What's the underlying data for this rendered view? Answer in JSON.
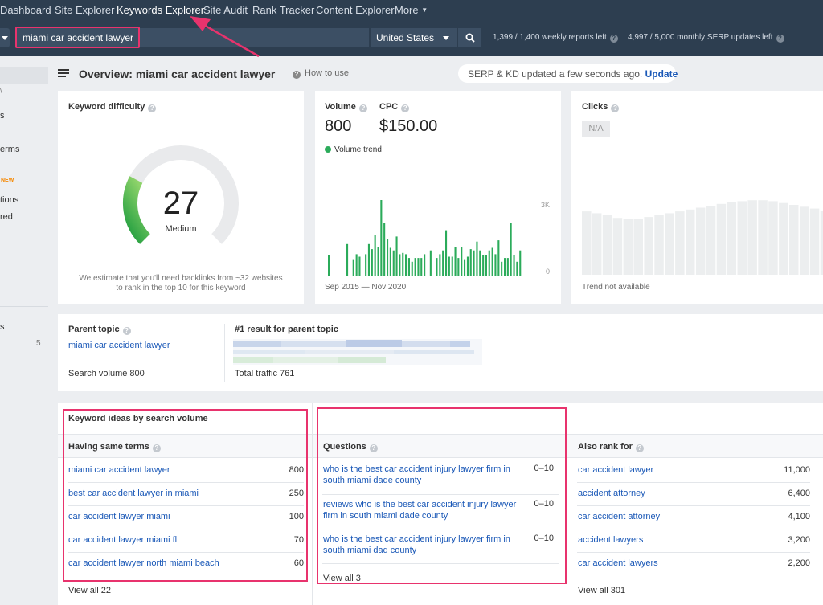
{
  "nav": {
    "items": [
      "Dashboard",
      "Site Explorer",
      "Keywords Explorer",
      "Site Audit",
      "Rank Tracker",
      "Content Explorer",
      "More"
    ],
    "active": "Keywords Explorer"
  },
  "search": {
    "query": "miami car accident lawyer",
    "country": "United States",
    "weekly_limit": "1,399 / 1,400 weekly reports left",
    "monthly_limit": "4,997 / 5,000 monthly SERP updates left"
  },
  "sidebar": {
    "fragments": [
      "s",
      "erms",
      "NEW",
      "tions",
      "red",
      "s",
      "5"
    ]
  },
  "header": {
    "title": "Overview: miami car accident lawyer",
    "how_to": "How to use",
    "serp_status": "SERP & KD updated a few seconds ago.",
    "update_link": "Update"
  },
  "kd": {
    "title": "Keyword difficulty",
    "value": "27",
    "level": "Medium",
    "gauge_fraction": 0.27,
    "note_line1": "We estimate that you'll need backlinks from ~32 websites",
    "note_line2": "to rank in the top 10 for this keyword"
  },
  "volume": {
    "volume_label": "Volume",
    "volume_value": "800",
    "cpc_label": "CPC",
    "cpc_value": "$150.00",
    "trend_label": "Volume trend",
    "axis_max": "3K",
    "axis_min": "0",
    "date_range": "Sep 2015 — Nov 2020",
    "trend_color": "#2bab5a"
  },
  "chart_data": {
    "type": "bar",
    "title": "Volume trend",
    "xlabel": "Sep 2015 — Nov 2020",
    "ylim": [
      0,
      3000
    ],
    "series": [
      {
        "name": "Volume trend",
        "values": [
          800,
          0,
          0,
          0,
          0,
          0,
          1250,
          0,
          650,
          850,
          750,
          0,
          850,
          1250,
          1050,
          1600,
          1150,
          3000,
          2100,
          1450,
          1100,
          1000,
          1550,
          850,
          900,
          850,
          700,
          550,
          700,
          700,
          700,
          850,
          0,
          1000,
          0,
          700,
          850,
          1000,
          1800,
          750,
          750,
          1150,
          700,
          1150,
          650,
          750,
          1050,
          1000,
          1350,
          1000,
          800,
          800,
          1000,
          1100,
          850,
          1400,
          550,
          700,
          700,
          2100,
          800,
          550,
          1000
        ]
      }
    ]
  },
  "clicks": {
    "title": "Clicks",
    "value": "N/A",
    "note": "Trend not available",
    "placeholder_heights": [
      0.68,
      0.66,
      0.64,
      0.61,
      0.6,
      0.6,
      0.62,
      0.64,
      0.66,
      0.68,
      0.7,
      0.72,
      0.74,
      0.76,
      0.78,
      0.79,
      0.8,
      0.8,
      0.79,
      0.77,
      0.75,
      0.73,
      0.71,
      0.69
    ]
  },
  "parent": {
    "label": "Parent topic",
    "keyword": "miami car accident lawyer",
    "search_volume": "Search volume 800",
    "first_result_label": "#1 result for parent topic",
    "total_traffic": "Total traffic 761"
  },
  "ideas": {
    "title": "Keyword ideas by search volume",
    "same_terms": {
      "header": "Having same terms",
      "rows": [
        {
          "keyword": "miami car accident lawyer",
          "volume": "800"
        },
        {
          "keyword": "best car accident lawyer in miami",
          "volume": "250"
        },
        {
          "keyword": "car accident lawyer miami",
          "volume": "100"
        },
        {
          "keyword": "car accident lawyer miami fl",
          "volume": "70"
        },
        {
          "keyword": "car accident lawyer north miami beach",
          "volume": "60"
        }
      ],
      "view_all": "View all 22"
    },
    "questions": {
      "header": "Questions",
      "rows": [
        {
          "keyword": "who is the best car accident injury lawyer firm in south miami dade county",
          "volume": "0–10"
        },
        {
          "keyword": "reviews who is the best car accident injury lawyer firm in south miami dade county",
          "volume": "0–10"
        },
        {
          "keyword": "who is the best car accident injury lawyer firm in south miami dad county",
          "volume": "0–10"
        }
      ],
      "view_all": "View all 3"
    },
    "also_rank": {
      "header": "Also rank for",
      "rows": [
        {
          "keyword": "car accident lawyer",
          "volume": "11,000"
        },
        {
          "keyword": "accident attorney",
          "volume": "6,400"
        },
        {
          "keyword": "car accident attorney",
          "volume": "4,100"
        },
        {
          "keyword": "accident lawyers",
          "volume": "3,200"
        },
        {
          "keyword": "car accident lawyers",
          "volume": "2,200"
        }
      ],
      "view_all": "View all 301"
    }
  },
  "colors": {
    "nav_bg": "#2d3e50",
    "link": "#1a58b7",
    "annotation": "#e8336d",
    "gauge_green": "#2bab5a"
  }
}
